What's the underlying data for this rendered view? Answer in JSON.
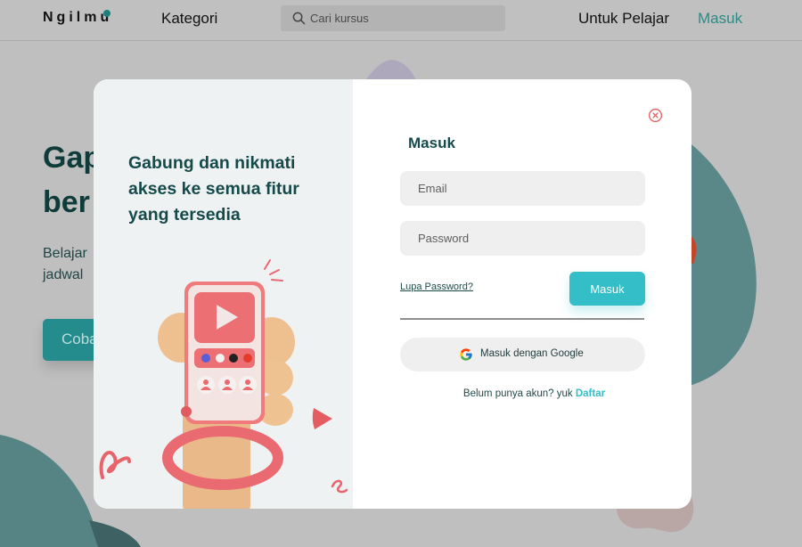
{
  "navbar": {
    "logo": "Ngilmu",
    "kategori": "Kategori",
    "search": {
      "placeholder": "Cari kursus",
      "icon": "search-icon"
    },
    "untuk_pelajar": "Untuk Pelajar",
    "masuk": "Masuk"
  },
  "hero": {
    "title_line1": "Gap",
    "title_line2": "ber",
    "sub_line1": "Belajar",
    "sub_line2": "jadwal",
    "cta": "Coba"
  },
  "modal": {
    "left_title": "Gabung dan nikmati akses ke semua fitur yang tersedia",
    "form_title": "Masuk",
    "email": {
      "placeholder": "Email",
      "value": ""
    },
    "password": {
      "placeholder": "Password",
      "value": ""
    },
    "forgot_password": "Lupa Password?",
    "submit": "Masuk",
    "google_button": "Masuk dengan Google",
    "signup_prompt": "Belum punya akun? yuk",
    "signup_link": "Daftar",
    "close_icon": "close-circle-icon"
  },
  "colors": {
    "brand_teal": "#1b7f7c",
    "primary_button": "#34bec7",
    "heading": "#164a4a",
    "close_red": "#e06a6a",
    "overlay_gray": "#bfbfbf"
  }
}
